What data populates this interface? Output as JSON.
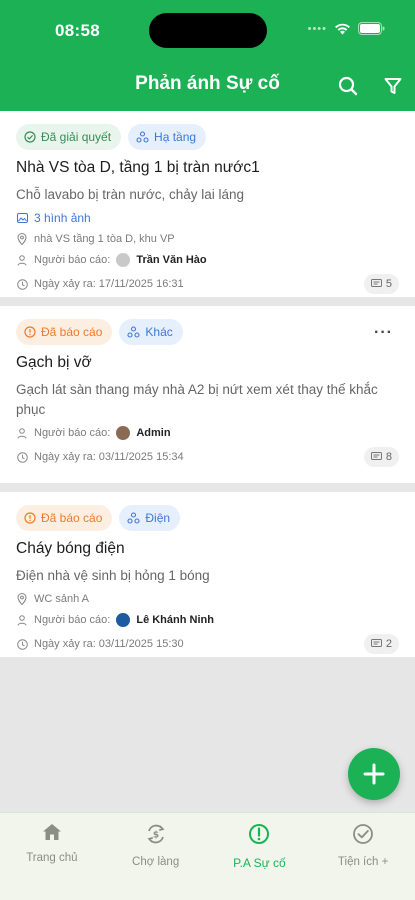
{
  "status_bar": {
    "time": "08:58"
  },
  "header": {
    "title": "Phản ánh Sự cố",
    "search_icon": "search-icon",
    "filter_icon": "filter-icon"
  },
  "colors": {
    "primary": "#1db155",
    "resolved": "#3a8b55",
    "reported": "#f07a2a",
    "category": "#3d78d8"
  },
  "cards": [
    {
      "status": "Đã giải quyết",
      "category": "Hạ tầng",
      "title": "Nhà VS tòa D, tầng 1 bị tràn nước1",
      "description": "Chỗ lavabo bị tràn nước, chảy lai láng",
      "images": "3 hình ảnh",
      "location": "nhà VS tầng 1 tòa D, khu VP",
      "reporter_label": "Người báo cáo:",
      "reporter": "Trần Văn Hào",
      "date": "Ngày xảy ra: 17/11/2025 16:31",
      "count": "5"
    },
    {
      "status": "Đã báo cáo",
      "category": "Khác",
      "title": "Gạch bị vỡ",
      "description": "Gạch lát sàn thang máy nhà A2 bị nứt xem xét thay thế khắc phục",
      "reporter_label": "Người báo cáo:",
      "reporter": "Admin",
      "date": "Ngày xảy ra: 03/11/2025 15:34",
      "count": "8",
      "more": "···"
    },
    {
      "status": "Đã báo cáo",
      "category": "Điện",
      "title": "Cháy bóng điện",
      "description": "Điện nhà vệ sinh bị hỏng 1 bóng",
      "location": "WC sảnh A",
      "reporter_label": "Người báo cáo:",
      "reporter": "Lê Khánh Ninh",
      "date": "Ngày xảy ra: 03/11/2025 15:30",
      "count": "2"
    }
  ],
  "fab": {
    "label": "+"
  },
  "tabs": [
    {
      "label": "Trang chủ",
      "icon": "home-icon"
    },
    {
      "label": "Chợ làng",
      "icon": "exchange-icon"
    },
    {
      "label": "P.A Sự cố",
      "icon": "alert-icon",
      "active": true
    },
    {
      "label": "Tiện ích +",
      "icon": "check-circle-icon"
    }
  ]
}
